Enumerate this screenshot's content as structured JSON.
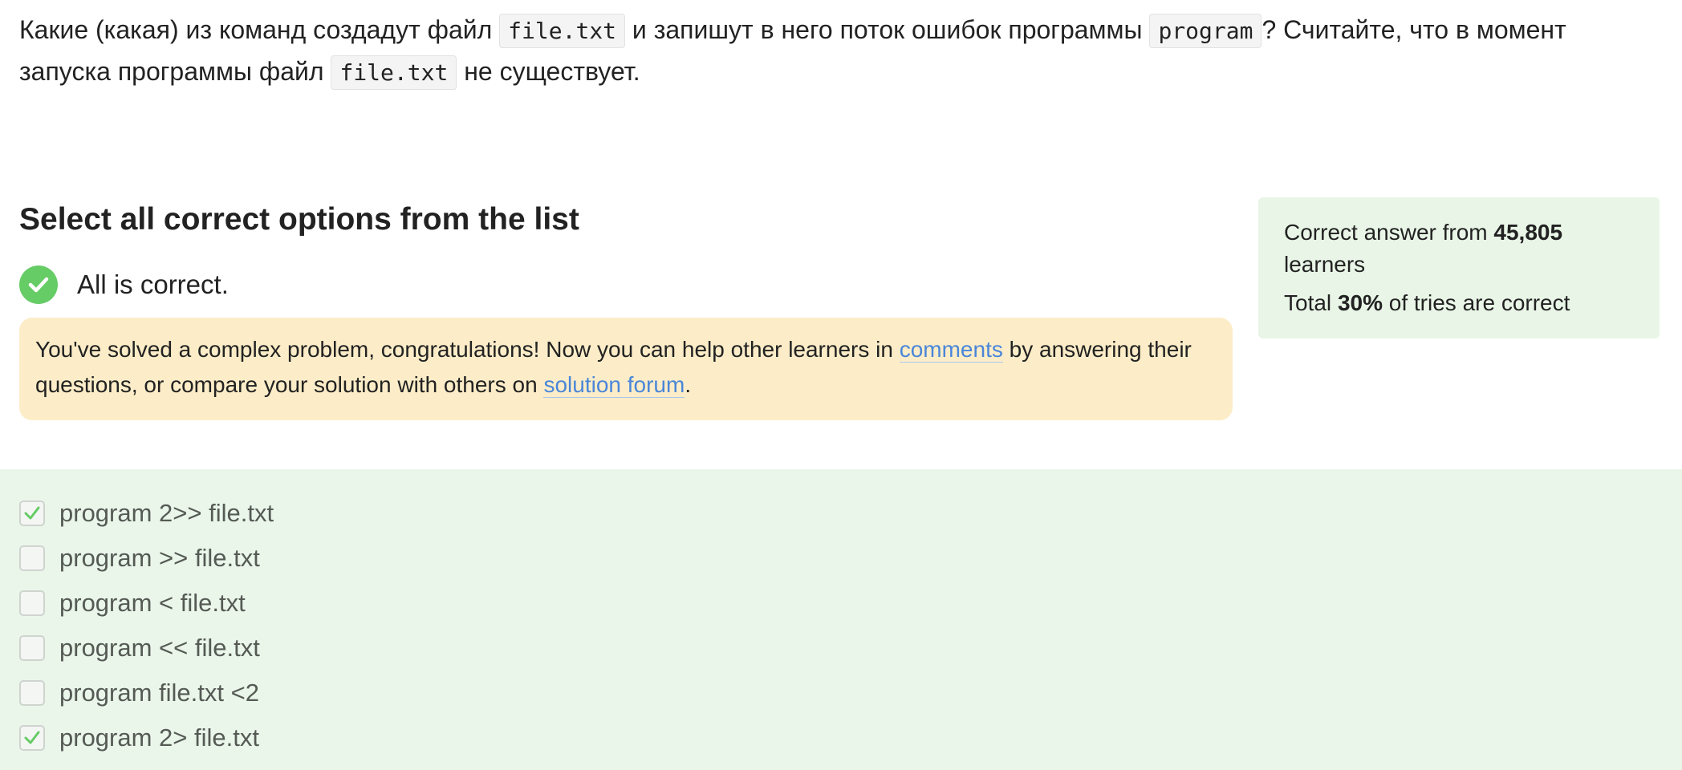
{
  "question": {
    "part1": "Какие (какая) из команд создадут файл ",
    "code1": "file.txt",
    "part2": " и запишут в него поток ошибок программы ",
    "code2": "program",
    "part3": "? Считайте, что в момент запуска программы файл ",
    "code3": "file.txt",
    "part4": " не существует."
  },
  "heading": "Select all correct options from the list",
  "status": {
    "text": "All is correct.",
    "icon": "checkmark-circle-icon",
    "color": "#66cc66"
  },
  "feedback": {
    "text1": "You've solved a complex problem, congratulations! Now you can help other learners in ",
    "link1": "comments",
    "text2": " by answering their questions, or compare your solution with others on ",
    "link2": "solution forum",
    "text3": ".",
    "background": "#fcedc8",
    "link_color": "#4a86d9"
  },
  "stats": {
    "line1_prefix": "Correct answer from ",
    "learners_count": "45,805",
    "line1_suffix": " learners",
    "line2_prefix": "Total ",
    "percent": "30%",
    "line2_suffix": " of tries are correct",
    "background": "#e9f6e7"
  },
  "options": [
    {
      "label": "program 2>> file.txt",
      "checked": true
    },
    {
      "label": "program >> file.txt",
      "checked": false
    },
    {
      "label": "program < file.txt",
      "checked": false
    },
    {
      "label": "program << file.txt",
      "checked": false
    },
    {
      "label": "program file.txt <2",
      "checked": false
    },
    {
      "label": "program 2> file.txt",
      "checked": true
    }
  ],
  "colors": {
    "options_background": "#eaf6ea",
    "check_mark": "#66cc66"
  }
}
